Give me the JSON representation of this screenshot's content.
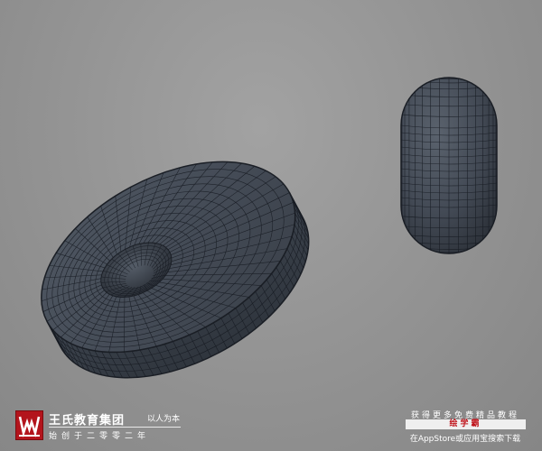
{
  "viewport": {
    "background": "#959595",
    "mesh_fill": "#3f4650",
    "mesh_line": "#141820"
  },
  "objects": [
    {
      "name": "capsule",
      "icon": "capsule-mesh-icon"
    },
    {
      "name": "torus",
      "icon": "torus-mesh-icon"
    }
  ],
  "brand": {
    "name": "王氏教育集团",
    "slogan": "以人为本",
    "sub": "始创于二零零二年",
    "logo_color": "#b3141c",
    "logo_icon": "wang-shi-logo-icon"
  },
  "promo": {
    "line1": "获得更多免费精品教程",
    "banner": "绘学霸",
    "line3": "在AppStore或应用宝搜索下载",
    "banner_color": "#c0141c"
  }
}
